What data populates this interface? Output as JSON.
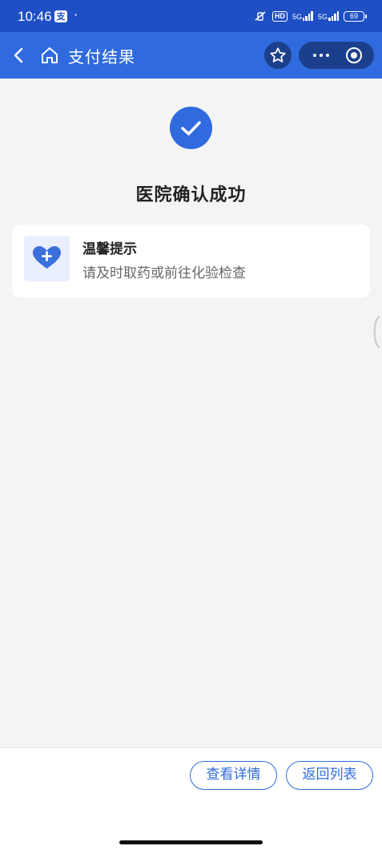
{
  "status_bar": {
    "time": "10:46",
    "app_badge": "支",
    "dot": "·",
    "hd": "HD",
    "sim1": "5G",
    "sim2": "5G",
    "battery": "69"
  },
  "navbar": {
    "title": "支付结果",
    "back_icon": "chevron-left-icon",
    "home_icon": "home-icon",
    "star_icon": "star-icon",
    "more_icon": "more-icon",
    "close_icon": "target-icon"
  },
  "result": {
    "title": "医院确认成功",
    "icon": "checkmark-icon"
  },
  "tip": {
    "icon": "heart-plus-icon",
    "title": "温馨提示",
    "text": "请及时取药或前往化验检查"
  },
  "actions": {
    "detail_label": "查看详情",
    "back_label": "返回列表"
  },
  "colors": {
    "primary": "#2f6bde",
    "status_bar": "#1f4fc4",
    "background": "#f4f4f4"
  }
}
